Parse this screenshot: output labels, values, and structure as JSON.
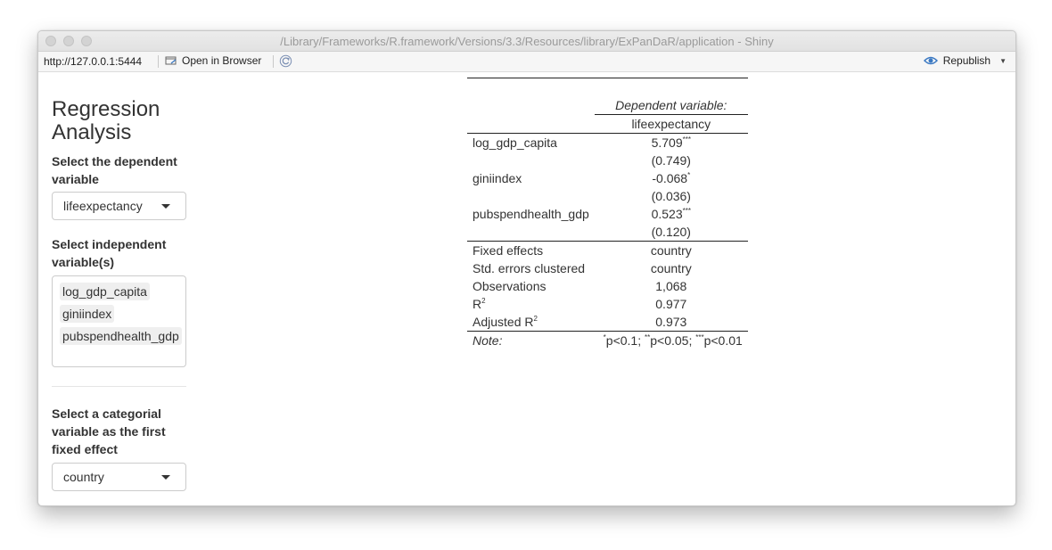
{
  "window": {
    "title": "/Library/Frameworks/R.framework/Versions/3.3/Resources/library/ExPanDaR/application - Shiny"
  },
  "toolbar": {
    "url": "http://127.0.0.1:5444",
    "open_in_browser": "Open in Browser",
    "republish": "Republish"
  },
  "sidebar": {
    "title": "Regression Analysis",
    "dep_label": "Select the dependent variable",
    "dep_value": "lifeexpectancy",
    "indep_label": "Select independent variable(s)",
    "indep_values": [
      "log_gdp_capita",
      "giniindex",
      "pubspendhealth_gdp"
    ],
    "fe_label": "Select a categorial variable as the first fixed effect",
    "fe_value": "country"
  },
  "regression": {
    "dep_header": "Dependent variable:",
    "dep_name": "lifeexpectancy",
    "rows": [
      {
        "name": "log_gdp_capita",
        "coef": "5.709",
        "stars": "***",
        "se": "(0.749)"
      },
      {
        "name": "giniindex",
        "coef": "-0.068",
        "stars": "*",
        "se": "(0.036)"
      },
      {
        "name": "pubspendhealth_gdp",
        "coef": "0.523",
        "stars": "***",
        "se": "(0.120)"
      }
    ],
    "stats": [
      {
        "label": "Fixed effects",
        "value": "country"
      },
      {
        "label": "Std. errors clustered",
        "value": "country"
      },
      {
        "label": "Observations",
        "value": "1,068"
      },
      {
        "label": "R",
        "sup": "2",
        "value": "0.977"
      },
      {
        "label": "Adjusted R",
        "sup": "2",
        "value": "0.973"
      }
    ],
    "note_label": "Note:",
    "note": {
      "s1": "*",
      "t1": "p<0.1; ",
      "s2": "**",
      "t2": "p<0.05; ",
      "s3": "***",
      "t3": "p<0.01"
    }
  }
}
